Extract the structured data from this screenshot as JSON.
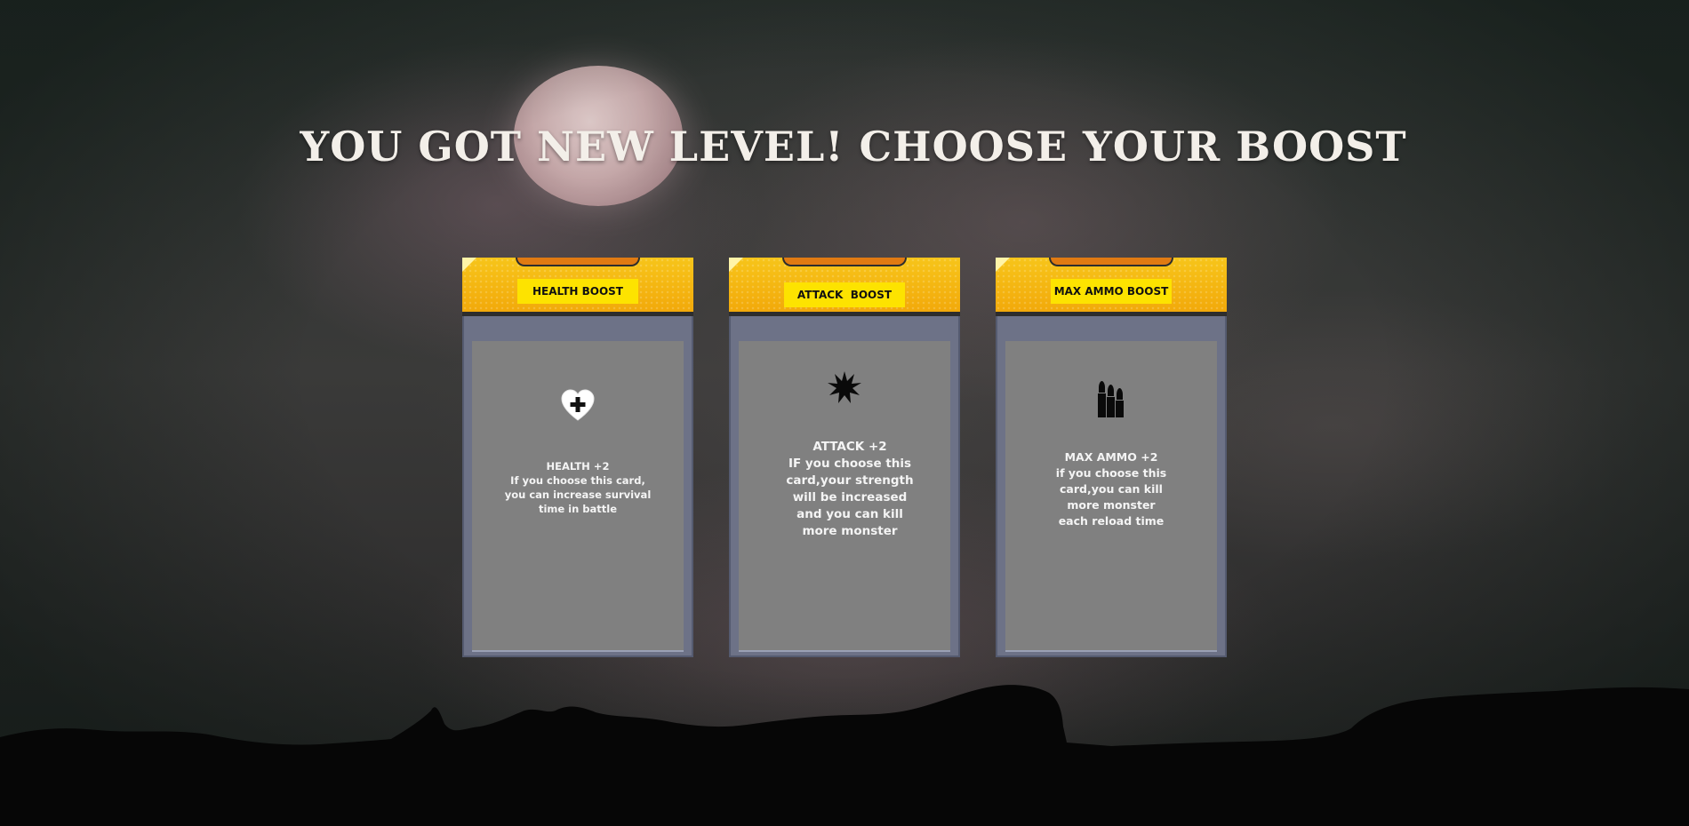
{
  "title": "YOU GOT NEW LEVEL! CHOOSE YOUR BOOST",
  "colors": {
    "header_yellow": "#f7c51a",
    "label_yellow": "#fde300",
    "card_frame": "#6d7287",
    "card_panel": "#808080"
  },
  "cards": [
    {
      "label": "HEALTH BOOST",
      "icon": "heart-plus-icon",
      "stat": "HEALTH +2",
      "description": "If you choose this card, you can increase survival time in battle"
    },
    {
      "label": "ATTACK  BOOST",
      "icon": "explosion-icon",
      "stat": "ATTACK +2",
      "description": "IF you choose this card,your strength will be increased and you can kill more monster"
    },
    {
      "label": "MAX AMMO BOOST",
      "icon": "bullets-icon",
      "stat": "MAX AMMO +2",
      "description": "if you choose this card,you can kill more monster each reload time"
    }
  ]
}
